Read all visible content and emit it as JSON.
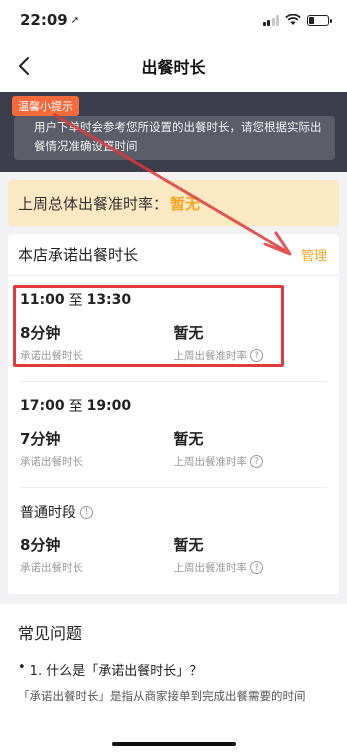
{
  "status_bar": {
    "time": "22:09",
    "location_icon": "location-arrow-icon"
  },
  "nav": {
    "title": "出餐时长",
    "back_icon": "chevron-left-icon"
  },
  "tip": {
    "badge": "温馨小提示",
    "text": "用户下单时会参考您所设置的出餐时长，请您根据实际出餐情况准确设置时间"
  },
  "rate": {
    "label": "上周总体出餐准时率：",
    "value": "暂无"
  },
  "commit": {
    "title": "本店承诺出餐时长",
    "manage_label": "管理",
    "slots": [
      {
        "start": "11:00",
        "sep": "至",
        "end": "13:30",
        "duration": "8分钟",
        "duration_label": "承诺出餐时长",
        "rate": "暂无",
        "rate_label": "上周出餐准时率"
      },
      {
        "start": "17:00",
        "sep": "至",
        "end": "19:00",
        "duration": "7分钟",
        "duration_label": "承诺出餐时长",
        "rate": "暂无",
        "rate_label": "上周出餐准时率"
      },
      {
        "name": "普通时段",
        "duration": "8分钟",
        "duration_label": "承诺出餐时长",
        "rate": "暂无",
        "rate_label": "上周出餐准时率"
      }
    ]
  },
  "faq": {
    "title": "常见问题",
    "q1": "1. 什么是「承诺出餐时长」？",
    "a1": "「承诺出餐时长」是指从商家接单到完成出餐需要的时间"
  },
  "colors": {
    "accent": "#f5a623",
    "highlight": "#e03a3a",
    "tip_bg": "#3c3e4b"
  }
}
